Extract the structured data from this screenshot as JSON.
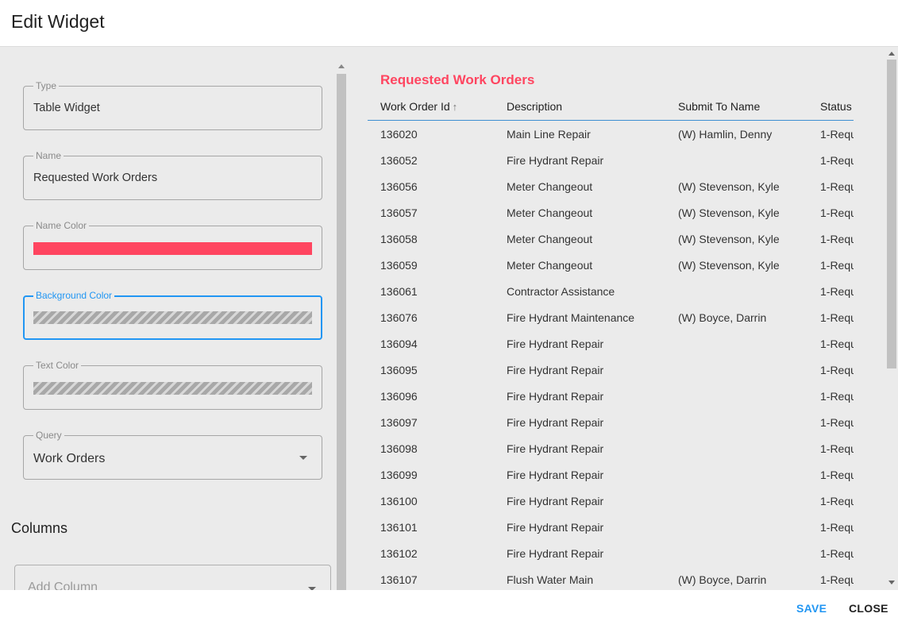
{
  "dialog": {
    "title": "Edit Widget"
  },
  "form": {
    "type": {
      "label": "Type",
      "value": "Table Widget"
    },
    "name": {
      "label": "Name",
      "value": "Requested Work Orders"
    },
    "name_color": {
      "label": "Name Color",
      "color": "#ff4560"
    },
    "background_color": {
      "label": "Background Color"
    },
    "text_color": {
      "label": "Text Color"
    },
    "query": {
      "label": "Query",
      "value": "Work Orders"
    },
    "columns_title": "Columns",
    "add_column": {
      "placeholder": "Add Column"
    }
  },
  "preview": {
    "title": "Requested Work Orders",
    "title_color": "#ff4560",
    "columns": [
      "Work Order Id",
      "Description",
      "Submit To Name",
      "Status"
    ],
    "sort_icon": "arrow-up-icon",
    "rows": [
      [
        "136020",
        "Main Line Repair",
        "(W) Hamlin, Denny",
        "1-Requ"
      ],
      [
        "136052",
        "Fire Hydrant Repair",
        "",
        "1-Requ"
      ],
      [
        "136056",
        "Meter Changeout",
        "(W) Stevenson, Kyle",
        "1-Requ"
      ],
      [
        "136057",
        "Meter Changeout",
        "(W) Stevenson, Kyle",
        "1-Requ"
      ],
      [
        "136058",
        "Meter Changeout",
        "(W) Stevenson, Kyle",
        "1-Requ"
      ],
      [
        "136059",
        "Meter Changeout",
        "(W) Stevenson, Kyle",
        "1-Requ"
      ],
      [
        "136061",
        "Contractor Assistance",
        "",
        "1-Requ"
      ],
      [
        "136076",
        "Fire Hydrant Maintenance",
        "(W) Boyce, Darrin",
        "1-Requ"
      ],
      [
        "136094",
        "Fire Hydrant Repair",
        "",
        "1-Requ"
      ],
      [
        "136095",
        "Fire Hydrant Repair",
        "",
        "1-Requ"
      ],
      [
        "136096",
        "Fire Hydrant Repair",
        "",
        "1-Requ"
      ],
      [
        "136097",
        "Fire Hydrant Repair",
        "",
        "1-Requ"
      ],
      [
        "136098",
        "Fire Hydrant Repair",
        "",
        "1-Requ"
      ],
      [
        "136099",
        "Fire Hydrant Repair",
        "",
        "1-Requ"
      ],
      [
        "136100",
        "Fire Hydrant Repair",
        "",
        "1-Requ"
      ],
      [
        "136101",
        "Fire Hydrant Repair",
        "",
        "1-Requ"
      ],
      [
        "136102",
        "Fire Hydrant Repair",
        "",
        "1-Requ"
      ],
      [
        "136107",
        "Flush Water Main",
        "(W) Boyce, Darrin",
        "1-Requ"
      ]
    ]
  },
  "footer": {
    "save_label": "SAVE",
    "close_label": "CLOSE"
  },
  "colors": {
    "accent": "#2196f3",
    "panel": "#ebebeb"
  }
}
